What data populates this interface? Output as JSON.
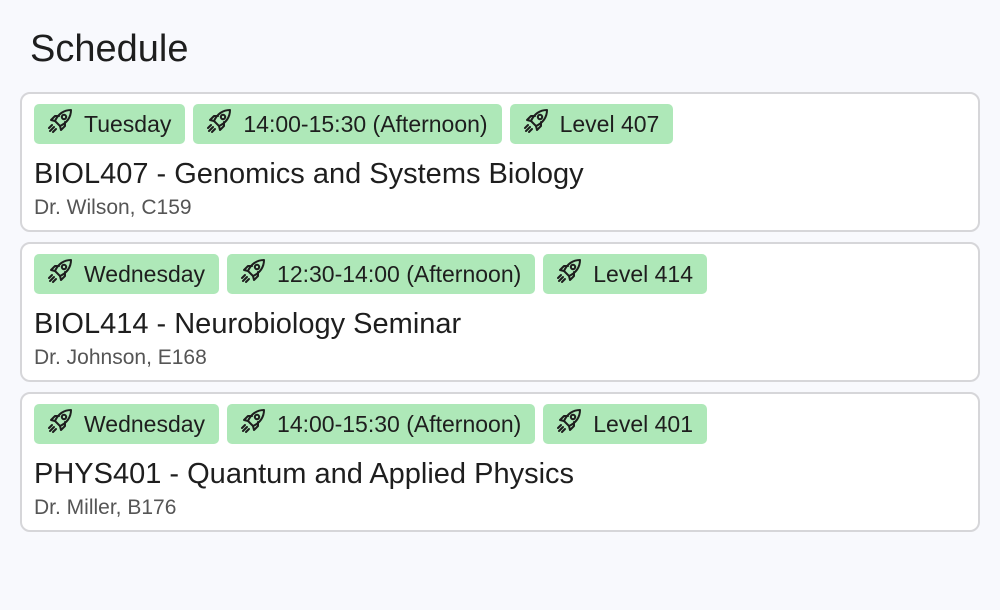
{
  "page": {
    "title": "Schedule"
  },
  "colors": {
    "tag_background": "#aee8b8",
    "card_border": "#d6d6d9",
    "page_background": "#f8f9fd"
  },
  "icons": {
    "tag_icon": "rocket-icon"
  },
  "courses": [
    {
      "tags": [
        "Tuesday",
        "14:00-15:30 (Afternoon)",
        "Level 407"
      ],
      "title": "BIOL407 - Genomics and Systems Biology",
      "meta": "Dr. Wilson, C159"
    },
    {
      "tags": [
        "Wednesday",
        "12:30-14:00 (Afternoon)",
        "Level 414"
      ],
      "title": "BIOL414 - Neurobiology Seminar",
      "meta": "Dr. Johnson, E168"
    },
    {
      "tags": [
        "Wednesday",
        "14:00-15:30 (Afternoon)",
        "Level 401"
      ],
      "title": "PHYS401 - Quantum and Applied Physics",
      "meta": "Dr. Miller, B176"
    }
  ]
}
